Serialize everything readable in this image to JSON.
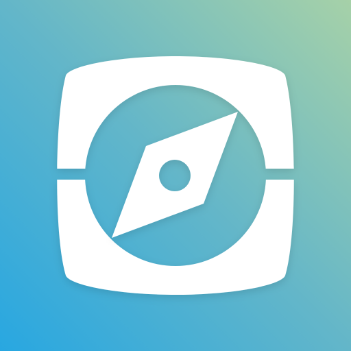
{
  "app_icon": {
    "icon_name": "compass-icon",
    "colors": {
      "background_start": "#28a7e1",
      "background_mid": "#63b6c9",
      "background_end": "#a6d1a8",
      "glyph": "#ffffff",
      "inner_circle": "#6cb4c6"
    }
  }
}
